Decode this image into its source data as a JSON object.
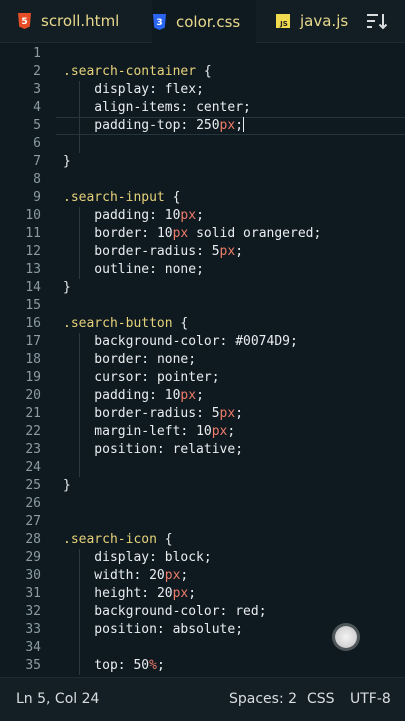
{
  "tabs": [
    {
      "label": "scroll.html",
      "icon": "html5-icon",
      "color": "#e44d26"
    },
    {
      "label": "color.css",
      "icon": "css3-icon",
      "color": "#2965f1",
      "active": true
    },
    {
      "label": "java.js",
      "icon": "js-icon",
      "color": "#f0db4f"
    }
  ],
  "editor": {
    "current_line": 5,
    "lines": [
      {
        "n": "1",
        "tokens": []
      },
      {
        "n": "2",
        "tokens": [
          [
            "sel",
            ".search-container"
          ],
          [
            "punc",
            " {"
          ]
        ]
      },
      {
        "n": "3",
        "tokens": [
          [
            "prop",
            "    display"
          ],
          [
            "punc",
            ": "
          ],
          [
            "val",
            "flex"
          ],
          [
            "punc",
            ";"
          ]
        ]
      },
      {
        "n": "4",
        "tokens": [
          [
            "prop",
            "    align-items"
          ],
          [
            "punc",
            ": "
          ],
          [
            "val",
            "center"
          ],
          [
            "punc",
            ";"
          ]
        ]
      },
      {
        "n": "5",
        "tokens": [
          [
            "prop",
            "    padding-top"
          ],
          [
            "punc",
            ": "
          ],
          [
            "num",
            "250"
          ],
          [
            "unit",
            "px"
          ],
          [
            "punc",
            ";"
          ]
        ],
        "cursor": true
      },
      {
        "n": "6",
        "tokens": []
      },
      {
        "n": "7",
        "tokens": [
          [
            "punc",
            "}"
          ]
        ]
      },
      {
        "n": "8",
        "tokens": []
      },
      {
        "n": "9",
        "tokens": [
          [
            "sel",
            ".search-input"
          ],
          [
            "punc",
            " {"
          ]
        ]
      },
      {
        "n": "10",
        "tokens": [
          [
            "prop",
            "    padding"
          ],
          [
            "punc",
            ": "
          ],
          [
            "num",
            "10"
          ],
          [
            "unit",
            "px"
          ],
          [
            "punc",
            ";"
          ]
        ]
      },
      {
        "n": "11",
        "tokens": [
          [
            "prop",
            "    border"
          ],
          [
            "punc",
            ": "
          ],
          [
            "num",
            "10"
          ],
          [
            "unit",
            "px"
          ],
          [
            "val",
            " solid orangered"
          ],
          [
            "punc",
            ";"
          ]
        ]
      },
      {
        "n": "12",
        "tokens": [
          [
            "prop",
            "    border-radius"
          ],
          [
            "punc",
            ": "
          ],
          [
            "num",
            "5"
          ],
          [
            "unit",
            "px"
          ],
          [
            "punc",
            ";"
          ]
        ]
      },
      {
        "n": "13",
        "tokens": [
          [
            "prop",
            "    outline"
          ],
          [
            "punc",
            ": "
          ],
          [
            "val",
            "none"
          ],
          [
            "punc",
            ";"
          ]
        ]
      },
      {
        "n": "14",
        "tokens": [
          [
            "punc",
            "}"
          ]
        ]
      },
      {
        "n": "15",
        "tokens": []
      },
      {
        "n": "16",
        "tokens": [
          [
            "sel",
            ".search-button"
          ],
          [
            "punc",
            " {"
          ]
        ]
      },
      {
        "n": "17",
        "tokens": [
          [
            "prop",
            "    background-color"
          ],
          [
            "punc",
            ": "
          ],
          [
            "val",
            "#0074D9"
          ],
          [
            "punc",
            ";"
          ]
        ]
      },
      {
        "n": "18",
        "tokens": [
          [
            "prop",
            "    border"
          ],
          [
            "punc",
            ": "
          ],
          [
            "val",
            "none"
          ],
          [
            "punc",
            ";"
          ]
        ]
      },
      {
        "n": "19",
        "tokens": [
          [
            "prop",
            "    cursor"
          ],
          [
            "punc",
            ": "
          ],
          [
            "val",
            "pointer"
          ],
          [
            "punc",
            ";"
          ]
        ]
      },
      {
        "n": "20",
        "tokens": [
          [
            "prop",
            "    padding"
          ],
          [
            "punc",
            ": "
          ],
          [
            "num",
            "10"
          ],
          [
            "unit",
            "px"
          ],
          [
            "punc",
            ";"
          ]
        ]
      },
      {
        "n": "21",
        "tokens": [
          [
            "prop",
            "    border-radius"
          ],
          [
            "punc",
            ": "
          ],
          [
            "num",
            "5"
          ],
          [
            "unit",
            "px"
          ],
          [
            "punc",
            ";"
          ]
        ]
      },
      {
        "n": "22",
        "tokens": [
          [
            "prop",
            "    margin-left"
          ],
          [
            "punc",
            ": "
          ],
          [
            "num",
            "10"
          ],
          [
            "unit",
            "px"
          ],
          [
            "punc",
            ";"
          ]
        ]
      },
      {
        "n": "23",
        "tokens": [
          [
            "prop",
            "    position"
          ],
          [
            "punc",
            ": "
          ],
          [
            "val",
            "relative"
          ],
          [
            "punc",
            ";"
          ]
        ]
      },
      {
        "n": "24",
        "tokens": []
      },
      {
        "n": "25",
        "tokens": [
          [
            "punc",
            "}"
          ]
        ]
      },
      {
        "n": "26",
        "tokens": []
      },
      {
        "n": "27",
        "tokens": []
      },
      {
        "n": "28",
        "tokens": [
          [
            "sel",
            ".search-icon"
          ],
          [
            "punc",
            " {"
          ]
        ]
      },
      {
        "n": "29",
        "tokens": [
          [
            "prop",
            "    display"
          ],
          [
            "punc",
            ": "
          ],
          [
            "val",
            "block"
          ],
          [
            "punc",
            ";"
          ]
        ]
      },
      {
        "n": "30",
        "tokens": [
          [
            "prop",
            "    width"
          ],
          [
            "punc",
            ": "
          ],
          [
            "num",
            "20"
          ],
          [
            "unit",
            "px"
          ],
          [
            "punc",
            ";"
          ]
        ]
      },
      {
        "n": "31",
        "tokens": [
          [
            "prop",
            "    height"
          ],
          [
            "punc",
            ": "
          ],
          [
            "num",
            "20"
          ],
          [
            "unit",
            "px"
          ],
          [
            "punc",
            ";"
          ]
        ]
      },
      {
        "n": "32",
        "tokens": [
          [
            "prop",
            "    background-color"
          ],
          [
            "punc",
            ": "
          ],
          [
            "val",
            "red"
          ],
          [
            "punc",
            ";"
          ]
        ]
      },
      {
        "n": "33",
        "tokens": [
          [
            "prop",
            "    position"
          ],
          [
            "punc",
            ": "
          ],
          [
            "val",
            "absolute"
          ],
          [
            "punc",
            ";"
          ]
        ]
      },
      {
        "n": "34",
        "tokens": []
      },
      {
        "n": "35",
        "tokens": [
          [
            "prop",
            "    top"
          ],
          [
            "punc",
            ": "
          ],
          [
            "num",
            "50"
          ],
          [
            "unit",
            "%"
          ],
          [
            "punc",
            ";"
          ]
        ]
      }
    ]
  },
  "status": {
    "position": "Ln 5, Col 24",
    "spaces": "Spaces: 2",
    "language": "CSS",
    "encoding": "UTF-8"
  }
}
